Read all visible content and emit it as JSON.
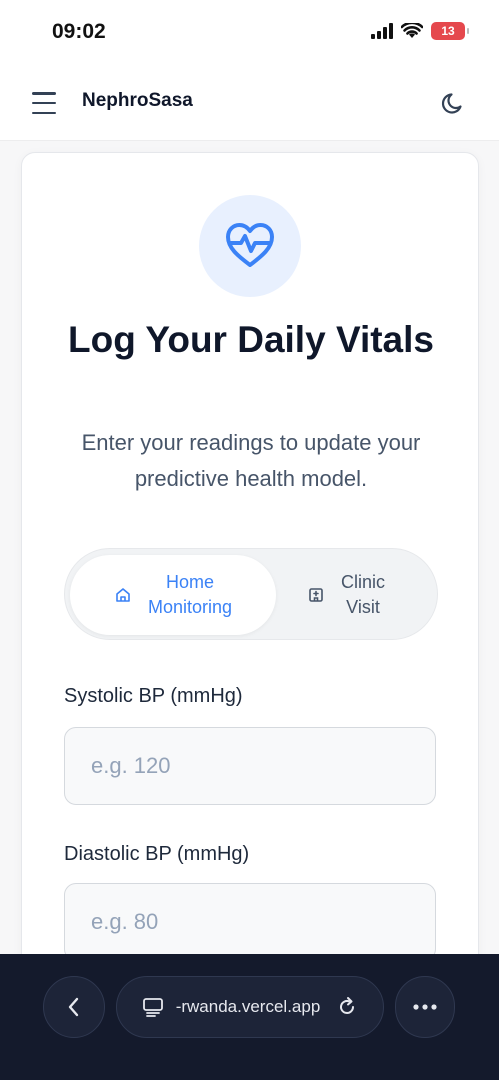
{
  "status_bar": {
    "time": "09:02",
    "battery": "13"
  },
  "header": {
    "brand": "NephroSasa"
  },
  "card": {
    "title": "Log Your Daily Vitals",
    "subtitle": "Enter your readings to update your predictive health model."
  },
  "toggle": {
    "home_line1": "Home",
    "home_line2": "Monitoring",
    "clinic_line1": "Clinic",
    "clinic_line2": "Visit",
    "selected": "Home Monitoring"
  },
  "fields": {
    "systolic_label": "Systolic BP (mmHg)",
    "systolic_placeholder": "e.g. 120",
    "diastolic_label": "Diastolic BP (mmHg)",
    "diastolic_placeholder": "e.g. 80"
  },
  "browser": {
    "url": "-rwanda.vercel.app"
  },
  "colors": {
    "accent": "#3b82f6",
    "accent_soft": "#e8f0fe",
    "browser_bg": "#141a2c",
    "battery": "#e5484d"
  }
}
